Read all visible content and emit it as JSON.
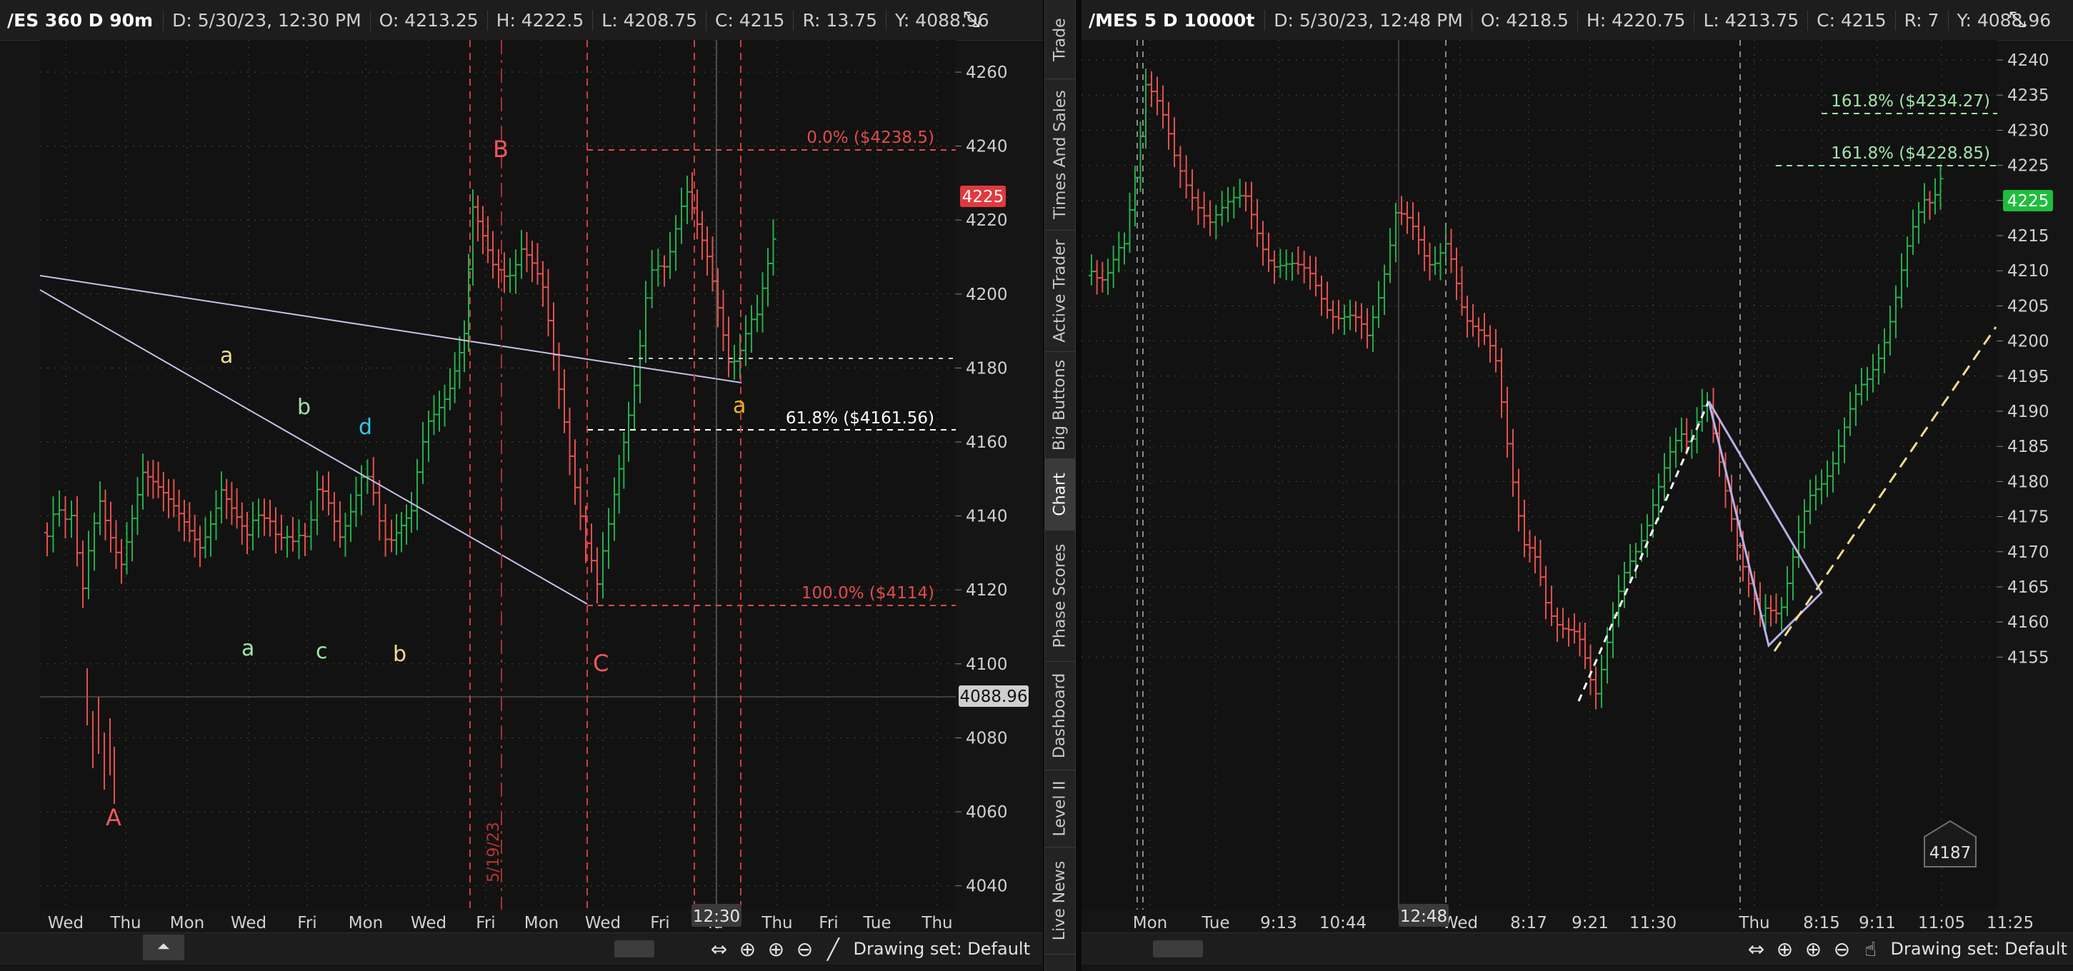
{
  "left_chart": {
    "header": {
      "symbol": "/ES 360 D 90m",
      "date": "D: 5/30/23, 12:30 PM",
      "open": "O: 4213.25",
      "high": "H: 4222.5",
      "low": "L: 4208.75",
      "close": "C: 4215",
      "range": "R: 13.75",
      "y": "Y: 4088.96"
    },
    "price_axis": [
      "4260",
      "4240",
      "4220",
      "4200",
      "4180",
      "4160",
      "4140",
      "4120",
      "4100",
      "4080",
      "4060",
      "4040"
    ],
    "time_axis": [
      "Wed",
      "Thu",
      "Mon",
      "Wed",
      "Fri",
      "Mon",
      "Wed",
      "Fri",
      "Mon",
      "Wed",
      "Fri",
      "Tu",
      "Thu",
      "Fri",
      "Tue",
      "Thu"
    ],
    "time_cursor": "12:30",
    "last_price": "4225",
    "cursor_price": "4088.96",
    "date_label": "5/19/23",
    "wave_labels": [
      {
        "text": "A",
        "color": "#f0585c"
      },
      {
        "text": "B",
        "color": "#f0585c"
      },
      {
        "text": "C",
        "color": "#f0585c"
      },
      {
        "text": "a",
        "color": "#f3dc8e"
      },
      {
        "text": "b",
        "color": "#9fe6a9"
      },
      {
        "text": "d",
        "color": "#34c9e8"
      },
      {
        "text": "a",
        "color": "#9fe6a9"
      },
      {
        "text": "c",
        "color": "#9fe6a9"
      },
      {
        "text": "b",
        "color": "#f3dc8e"
      },
      {
        "text": "a",
        "color": "#f0b21e"
      }
    ],
    "fib_labels": [
      "0.0%  ($4238.5)",
      "61.8%  ($4161.56)",
      "100.0%  ($4114)"
    ],
    "colors": {
      "up": "#22b04a",
      "down": "#e5504c",
      "fib_red": "#e14b4b",
      "trend": "#c8c0e8"
    },
    "footer": {
      "drawing_set": "Drawing set: Default"
    }
  },
  "right_chart": {
    "header": {
      "symbol": "/MES 5 D 10000t",
      "date": "D: 5/30/23, 12:48 PM",
      "open": "O: 4218.5",
      "high": "H: 4220.75",
      "low": "L: 4213.75",
      "close": "C: 4215",
      "range": "R: 7",
      "y": "Y: 4088.96"
    },
    "price_axis": [
      "4240",
      "4235",
      "4230",
      "4225",
      "4220",
      "4215",
      "4210",
      "4205",
      "4200",
      "4195",
      "4190",
      "4185",
      "4180",
      "4175",
      "4170",
      "4165",
      "4160",
      "4155"
    ],
    "time_axis": [
      "Mon",
      "Tue",
      "9:13",
      "10:44",
      "Wed",
      "8:17",
      "9:21",
      "11:30",
      "Thu",
      "8:15",
      "9:11",
      "11:05",
      "11:25"
    ],
    "time_cursor": "12:48",
    "last_price": "4225",
    "price_box": "4187",
    "fib_labels": [
      "161.8%  ($4234.27)",
      "161.8%  ($4228.85)"
    ],
    "footer": {
      "drawing_set": "Drawing set: Default"
    }
  },
  "side_tabs": [
    "Trade",
    "Times And Sales",
    "Active Trader",
    "Big Buttons",
    "Chart",
    "Phase Scores",
    "Dashboard",
    "Level II",
    "Live News"
  ],
  "active_tab": "Chart",
  "icons": {
    "close": "cross-arrow-icon",
    "warning": "exclamation-icon",
    "tools": [
      "arrows-icon",
      "crosshair-icon",
      "zoom-in-icon",
      "zoom-out-icon",
      "pencil-icon",
      "hand-icon"
    ]
  }
}
